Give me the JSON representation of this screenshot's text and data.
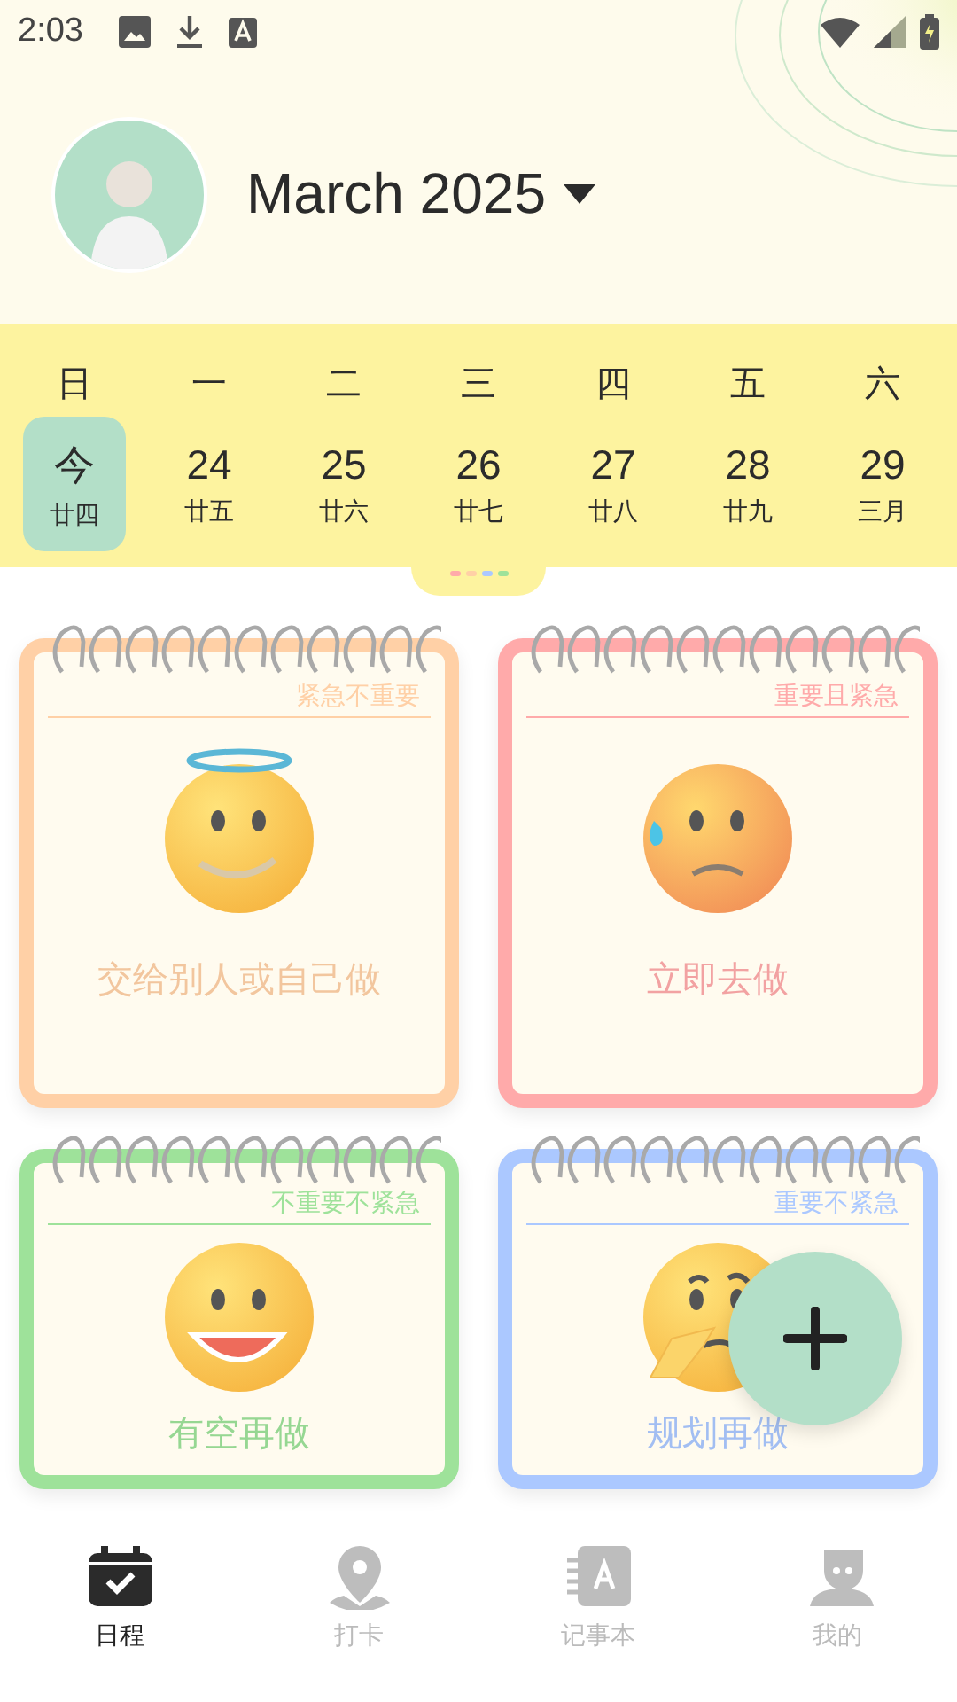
{
  "status_bar": {
    "time": "2:03"
  },
  "header": {
    "month": "March 2025"
  },
  "calendar": {
    "weekdays": [
      "日",
      "一",
      "二",
      "三",
      "四",
      "五",
      "六"
    ],
    "days": [
      {
        "day": "今",
        "lunar": "廿四",
        "selected": true
      },
      {
        "day": "24",
        "lunar": "廿五",
        "selected": false
      },
      {
        "day": "25",
        "lunar": "廿六",
        "selected": false
      },
      {
        "day": "26",
        "lunar": "廿七",
        "selected": false
      },
      {
        "day": "27",
        "lunar": "廿八",
        "selected": false
      },
      {
        "day": "28",
        "lunar": "廿九",
        "selected": false
      },
      {
        "day": "29",
        "lunar": "三月",
        "selected": false
      }
    ],
    "legend": [
      {
        "color": "#ffaaaa"
      },
      {
        "color": "#ffd0a6"
      },
      {
        "color": "#abc8ff"
      },
      {
        "color": "#9ee29a"
      }
    ]
  },
  "quadrants": [
    {
      "tag": "紧急不重要",
      "label": "交给别人或自己做",
      "color": "#ffd0a6",
      "kind": "halo"
    },
    {
      "tag": "重要且紧急",
      "label": "立即去做",
      "color": "#ffaaaa",
      "kind": "sweat"
    },
    {
      "tag": "不重要不紧急",
      "label": "有空再做",
      "color": "#9ee29a",
      "kind": "grin"
    },
    {
      "tag": "重要不紧急",
      "label": "规划再做",
      "color": "#abc8ff",
      "kind": "thinking"
    }
  ],
  "nav": [
    {
      "label": "日程",
      "kind": "calendar",
      "selected": true
    },
    {
      "label": "打卡",
      "kind": "pin",
      "selected": false
    },
    {
      "label": "记事本",
      "kind": "notebook",
      "selected": false
    },
    {
      "label": "我的",
      "kind": "person",
      "selected": false
    }
  ]
}
